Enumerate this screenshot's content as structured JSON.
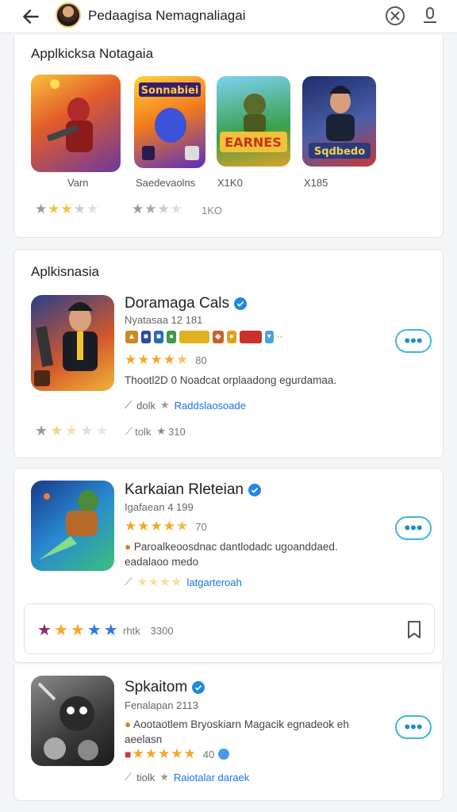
{
  "topbar": {
    "title": "Pedaagisa Nemagnaliagai",
    "back_icon": "arrow-left-icon",
    "share_icon": "x-circle-icon",
    "profile_icon": "person-icon"
  },
  "featured": {
    "title": "Applkicksa Notagaia",
    "items": [
      {
        "caption": "Varn",
        "rating_text": "",
        "colors": [
          "#d8452a",
          "#5d3b8c"
        ]
      },
      {
        "caption": "Saedevaolns",
        "rating_text": "1KO",
        "colors": [
          "#f0a22a",
          "#3a4fd0"
        ]
      },
      {
        "caption": "X1K0",
        "rating_text": "",
        "colors": [
          "#2fa24a",
          "#e8b82a"
        ]
      },
      {
        "caption": "X185",
        "rating_text": "",
        "colors": [
          "#2b3c7a",
          "#c83a3a"
        ]
      }
    ]
  },
  "list_section": {
    "title": "Aplkisnasia"
  },
  "apps": [
    {
      "name": "Doramaga Cals",
      "sub": "Nyatasaa 12 181",
      "rating_num": "80",
      "stars": 4.5,
      "desc": "Thootl2D 0 Noadcat orplaadong egurdamaa.",
      "link_prefix": "dolk",
      "link_text": "Raddslaosoade",
      "foot_text": "tolk",
      "foot_num": "310",
      "more": "•••"
    },
    {
      "name": "Karkaian Rleteian",
      "sub": "Igafaean 4 199",
      "rating_num": "70",
      "stars": 4.5,
      "desc": "Paroalkeoosdnac dantlodadc ugoanddaed. eadalaoo medo",
      "link_text": "latgarteroah",
      "foot_text": "rhtk",
      "foot_num": "3300",
      "more": "•••"
    },
    {
      "name": "Spkaitom",
      "sub": "Fenalapan 2113",
      "rating_num": "40",
      "stars": 5,
      "desc": "Aootaotlem Bryoskiarn Magacik egnadeok eh aeelasn",
      "link_prefix": "tiolk",
      "link_text": "Raiotalar daraek",
      "more": "•••"
    }
  ],
  "colors": {
    "accent": "#1a73e8",
    "star": "#f5a623",
    "button_border": "#3fb6e0"
  }
}
